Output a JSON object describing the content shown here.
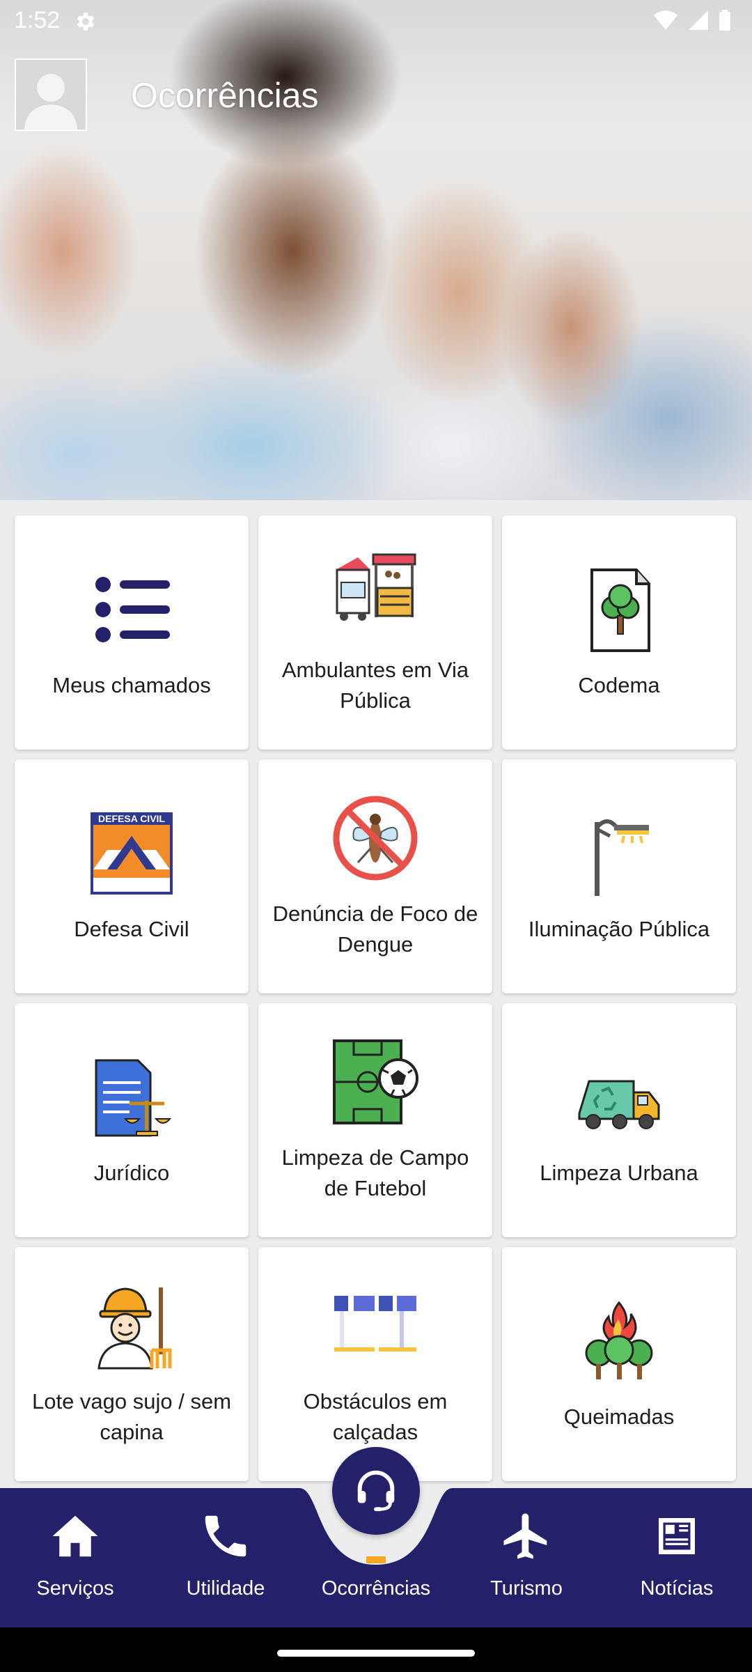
{
  "status_bar": {
    "time": "1:52"
  },
  "header": {
    "title": "Ocorrências"
  },
  "colors": {
    "primary": "#25206a",
    "accent": "#f5a623",
    "background": "#ededed"
  },
  "services": [
    {
      "label": "Meus chamados",
      "icon": "list-icon"
    },
    {
      "label": "Ambulantes em Via Pública",
      "icon": "street-vendor-stall-icon"
    },
    {
      "label": "Codema",
      "icon": "tree-document-icon"
    },
    {
      "label": "Defesa Civil",
      "icon": "defesa-civil-logo-icon",
      "icon_text": "DEFESA CIVIL"
    },
    {
      "label": "Denúncia de Foco de Dengue",
      "icon": "no-mosquito-icon"
    },
    {
      "label": "Iluminação Pública",
      "icon": "street-light-icon"
    },
    {
      "label": "Jurídico",
      "icon": "legal-document-scales-icon"
    },
    {
      "label": "Limpeza de Campo de Futebol",
      "icon": "soccer-field-ball-icon"
    },
    {
      "label": "Limpeza Urbana",
      "icon": "recycling-truck-icon"
    },
    {
      "label": "Lote vago sujo / sem capina",
      "icon": "worker-rake-icon"
    },
    {
      "label": "Obstáculos em calçadas",
      "icon": "barrier-icon"
    },
    {
      "label": "Queimadas",
      "icon": "burning-trees-icon"
    }
  ],
  "bottom_nav": {
    "items": [
      {
        "label": "Serviços",
        "icon": "home-icon"
      },
      {
        "label": "Utilidade",
        "icon": "phone-icon"
      },
      {
        "label": "Ocorrências",
        "icon": "headset-icon",
        "selected": true
      },
      {
        "label": "Turismo",
        "icon": "airplane-icon"
      },
      {
        "label": "Notícias",
        "icon": "newspaper-icon"
      }
    ]
  }
}
